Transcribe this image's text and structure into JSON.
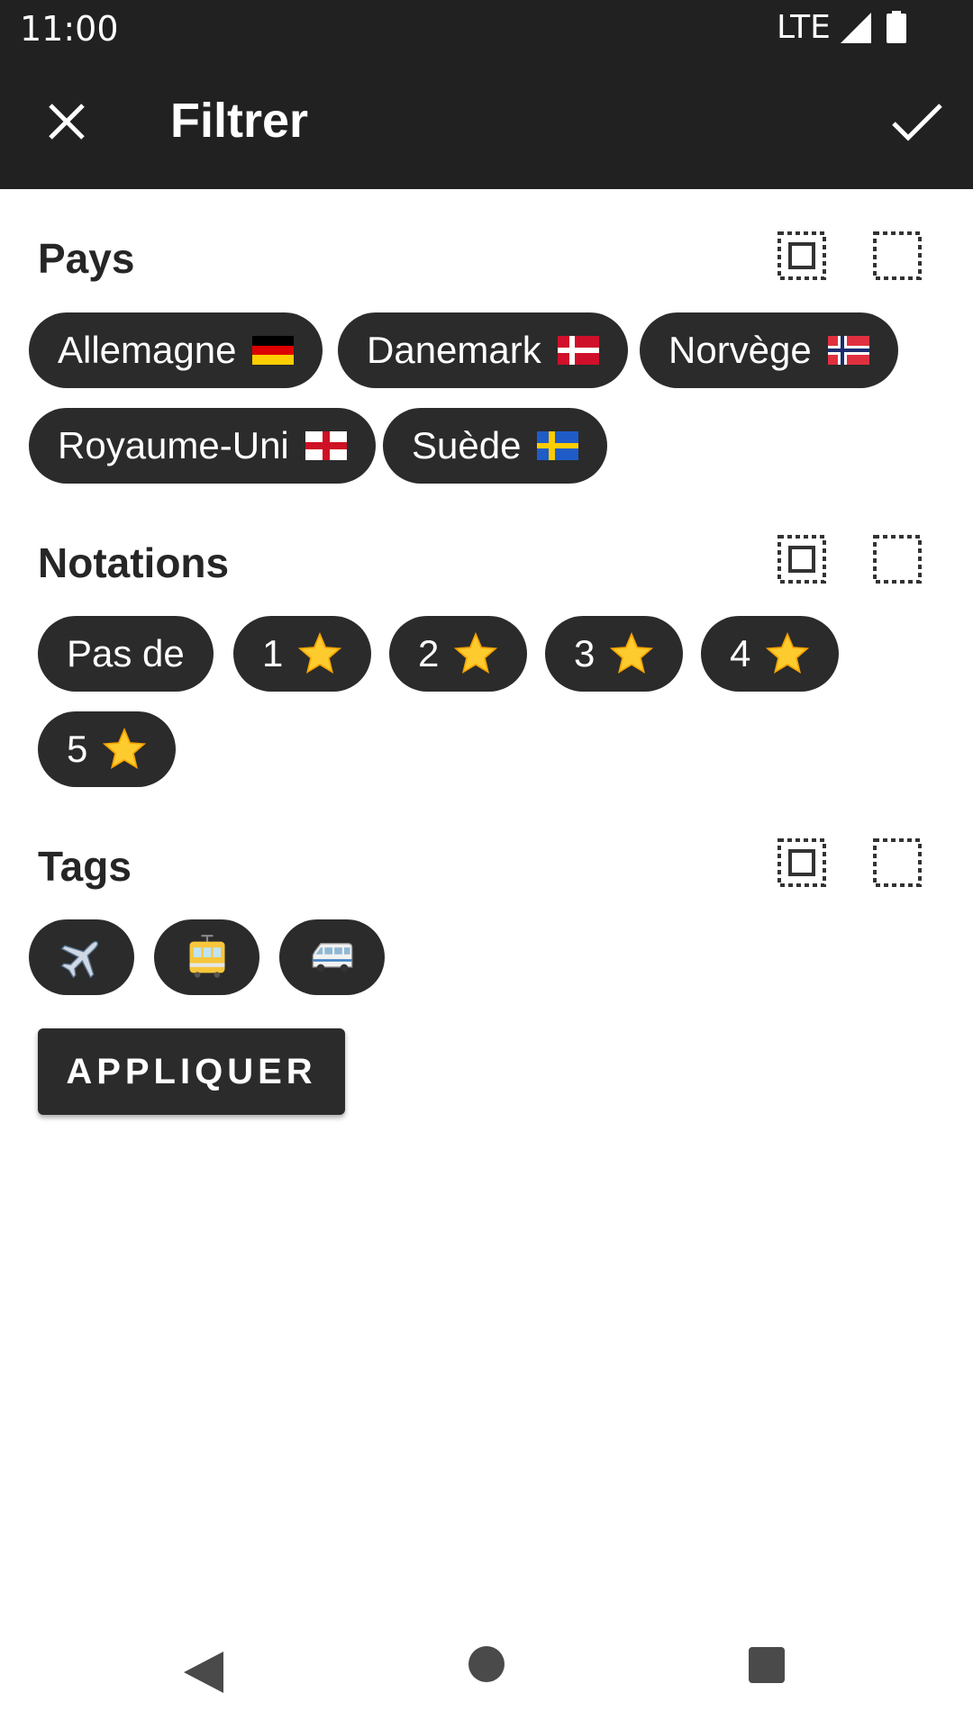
{
  "status_bar": {
    "time": "11:00",
    "network": "LTE"
  },
  "app_bar": {
    "title": "Filtrer"
  },
  "sections": {
    "pays": {
      "title": "Pays",
      "chips": [
        {
          "label": "Allemagne",
          "flag": "germany-flag-icon"
        },
        {
          "label": "Danemark",
          "flag": "denmark-flag-icon"
        },
        {
          "label": "Norvège",
          "flag": "norway-flag-icon"
        },
        {
          "label": "Royaume-Uni",
          "flag": "england-flag-icon"
        },
        {
          "label": "Suède",
          "flag": "sweden-flag-icon"
        }
      ]
    },
    "notations": {
      "title": "Notations",
      "chips": [
        {
          "label": "Pas de"
        },
        {
          "label": "1",
          "icon": "star-icon"
        },
        {
          "label": "2",
          "icon": "star-icon"
        },
        {
          "label": "3",
          "icon": "star-icon"
        },
        {
          "label": "4",
          "icon": "star-icon"
        },
        {
          "label": "5",
          "icon": "star-icon"
        }
      ]
    },
    "tags": {
      "title": "Tags",
      "chips": [
        {
          "icon": "airplane-icon"
        },
        {
          "icon": "tram-icon"
        },
        {
          "icon": "minibus-icon"
        }
      ]
    }
  },
  "apply_button": {
    "label": "APPLIQUER"
  },
  "colors": {
    "bar": "#212121",
    "chip": "#2b2b2b",
    "star": "#fdcb2e"
  }
}
